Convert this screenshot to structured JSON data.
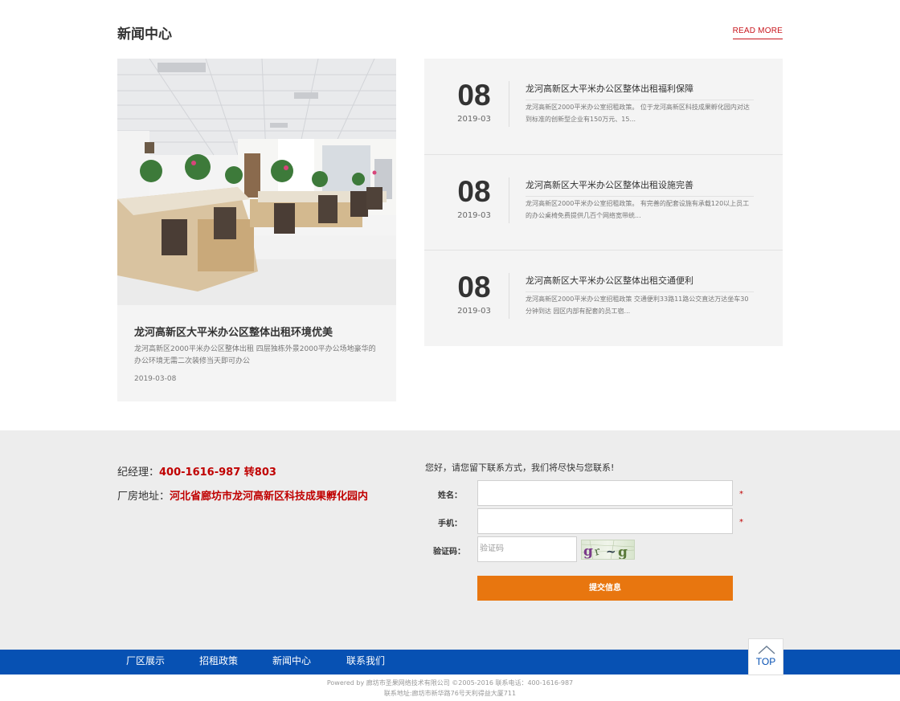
{
  "news": {
    "title": "新闻中心",
    "read_more": "READ MORE",
    "feature": {
      "title": "龙河高新区大平米办公区整体出租环境优美",
      "desc": "龙河高新区2000平米办公区整体出租 四层独栋外景2000平办公场地豪华的办公环境无需二次装修当天即可办公",
      "date": "2019-03-08"
    },
    "items": [
      {
        "day": "08",
        "ym": "2019-03",
        "title": "龙河高新区大平米办公区整体出租福利保障",
        "desc": "龙河高新区2000平米办公室招租政策。 位于龙河高新区科技成果孵化园内对达到标准的创新型企业有150万元、15..."
      },
      {
        "day": "08",
        "ym": "2019-03",
        "title": "龙河高新区大平米办公区整体出租设施完善",
        "desc": "龙河高新区2000平米办公室招租政策。 有完善的配套设施有承载120以上员工的办公桌椅免费提供几百个网络宽带统..."
      },
      {
        "day": "08",
        "ym": "2019-03",
        "title": "龙河高新区大平米办公区整体出租交通便利",
        "desc": "龙河高新区2000平米办公室招租政策 交通便利33路11路公交直达万达坐车30分钟到达 园区内部有配套的员工宿..."
      }
    ]
  },
  "contact": {
    "manager_label": "纪经理：",
    "manager_value": "400-1616-987 转803",
    "address_label": "厂房地址：",
    "address_value": "河北省廊坊市龙河高新区科技成果孵化园内",
    "form_intro": "您好，请您留下联系方式，我们将尽快与您联系!",
    "name_label": "姓名：",
    "phone_label": "手机：",
    "code_label": "验证码：",
    "code_placeholder": "验证码",
    "required_mark": "*",
    "captcha_text": "g↵⌐g",
    "submit_label": "提交信息"
  },
  "footer": {
    "nav": [
      "厂区展示",
      "招租政策",
      "新闻中心",
      "联系我们"
    ],
    "top_label": "TOP",
    "copyright": "Powered by 廊坊市圣果网络技术有限公司 ©2005-2016 联系电话：400-1616-987",
    "address": "联系地址:廊坊市新华路76号天利得益大厦711"
  },
  "colors": {
    "accent_red": "#c00000",
    "nav_blue": "#0751b3",
    "submit_orange": "#e8760f"
  }
}
